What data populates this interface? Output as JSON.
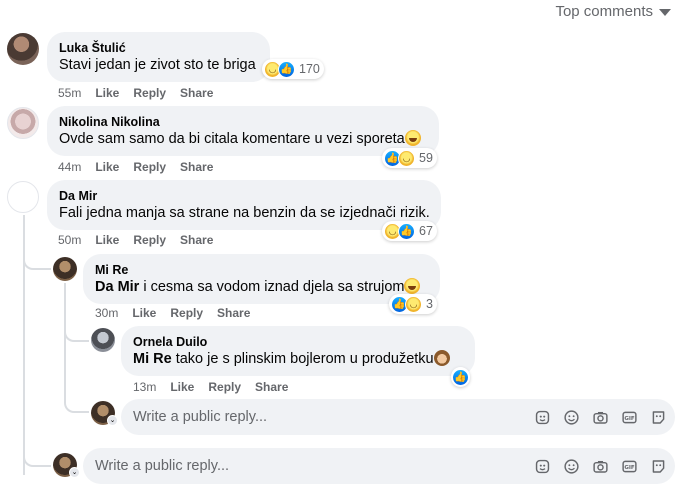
{
  "header": {
    "sort_label": "Top comments"
  },
  "comments": [
    {
      "author": "Luka Štulić",
      "text": "Stavi jedan je zivot sto te briga",
      "time": "55m",
      "reaction_count": "170",
      "reactions": [
        "haha-icon",
        "like-icon"
      ]
    },
    {
      "author": "Nikolina Nikolina",
      "text": "Ovde sam samo da bi citala komentare u vezi sporeta",
      "time": "44m",
      "reaction_count": "59",
      "reactions": [
        "like-icon",
        "haha-icon"
      ]
    },
    {
      "author": "Da Mir",
      "text": "Fali jedna manja sa strane na benzin da se izjednači rizik.",
      "time": "50m",
      "reaction_count": "67",
      "reactions": [
        "haha-icon",
        "like-icon"
      ]
    },
    {
      "author": "Mi Re",
      "mention": "Da Mir",
      "text": " i cesma sa vodom iznad djela sa strujom",
      "time": "30m",
      "reaction_count": "3",
      "reactions": [
        "like-icon",
        "haha-icon"
      ]
    },
    {
      "author": "Ornela Duilo",
      "mention": "Mi Re",
      "text": " tako je s plinskim bojlerom u produžetku",
      "time": "13m",
      "reactions": [
        "like-icon"
      ]
    }
  ],
  "actions": {
    "like": "Like",
    "reply": "Reply",
    "share": "Share"
  },
  "reply_box": {
    "placeholder": "Write a public reply..."
  },
  "tools": [
    "sticker-icon",
    "emoji-icon",
    "camera-icon",
    "gif-icon",
    "avatar-sticker-icon"
  ]
}
